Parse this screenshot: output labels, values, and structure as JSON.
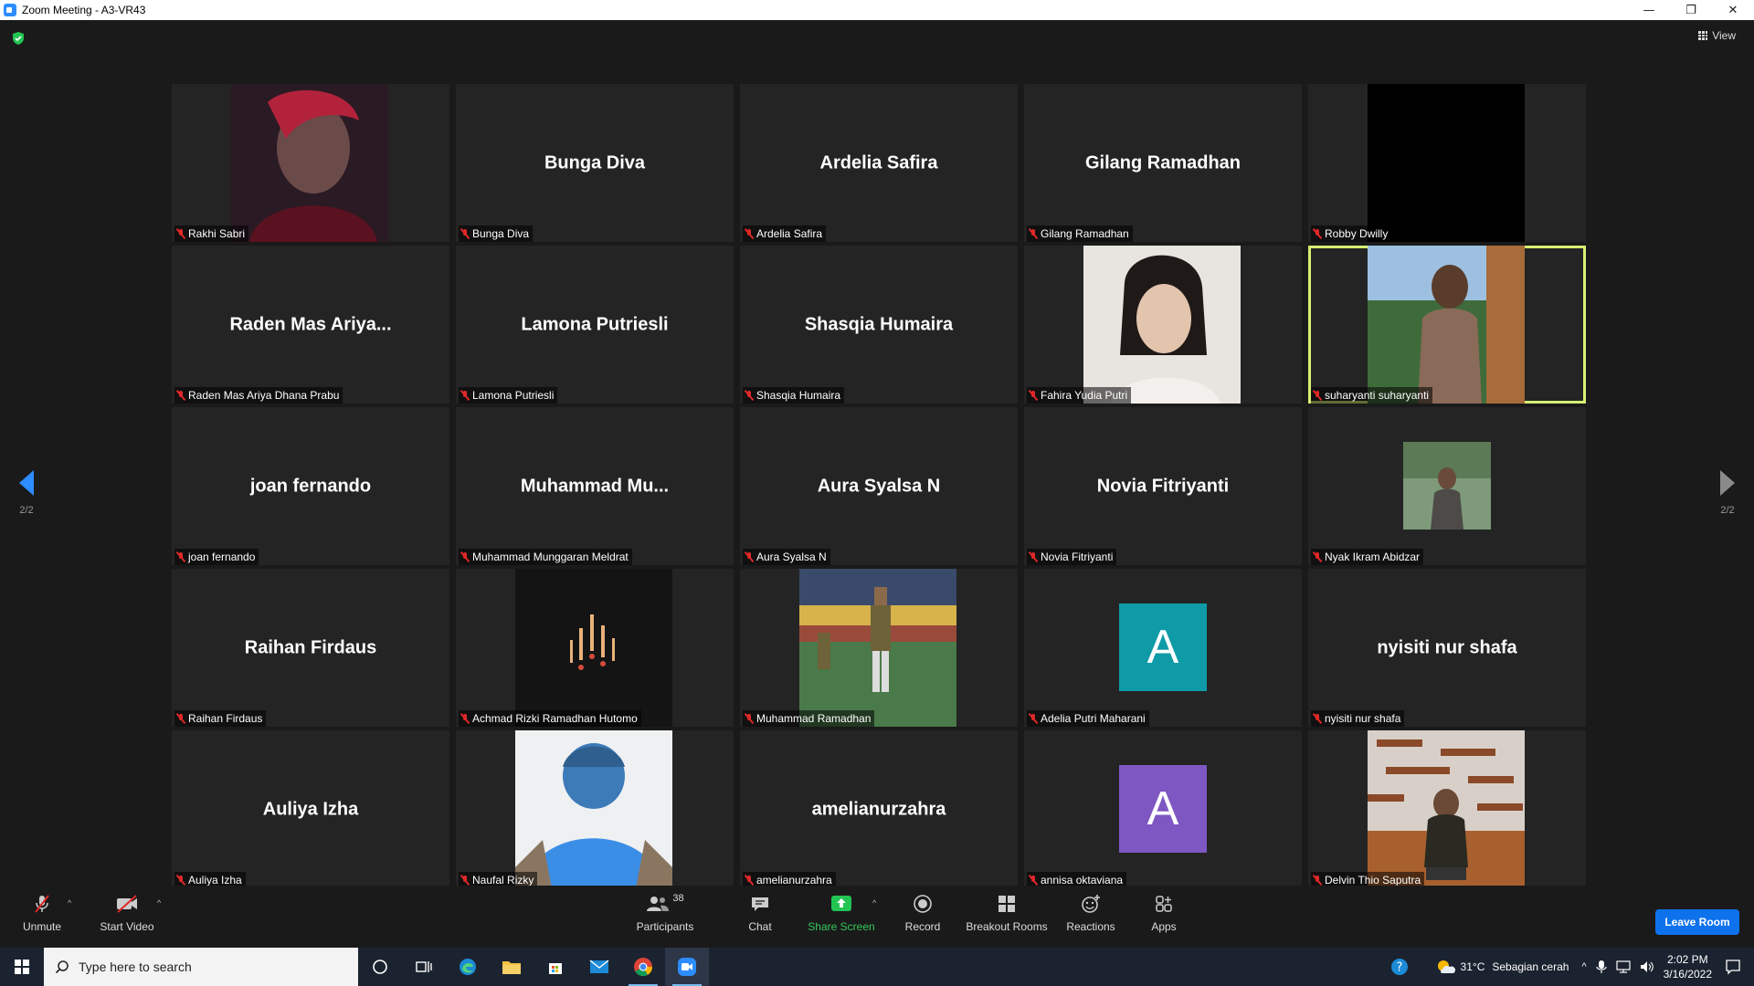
{
  "window": {
    "title": "Zoom Meeting - A3-VR43",
    "minimize": "—",
    "restore": "❐",
    "close": "✕"
  },
  "top_bar": {
    "view_label": "View"
  },
  "pagination": {
    "left": "2/2",
    "right": "2/2"
  },
  "participants": [
    {
      "display": "",
      "name": "Rakhi Sabri",
      "photo": "photo-red-hair"
    },
    {
      "display": "Bunga Diva",
      "name": "Bunga Diva"
    },
    {
      "display": "Ardelia Safira",
      "name": "Ardelia Safira"
    },
    {
      "display": "Gilang Ramadhan",
      "name": "Gilang Ramadhan"
    },
    {
      "display": "",
      "name": "Robby Dwilly",
      "photo": "photo-black"
    },
    {
      "display": "Raden Mas Ariya...",
      "name": "Raden Mas Ariya Dhana Prabu"
    },
    {
      "display": "Lamona Putriesli",
      "name": "Lamona Putriesli"
    },
    {
      "display": "Shasqia Humaira",
      "name": "Shasqia Humaira"
    },
    {
      "display": "",
      "name": "Fahira Yudia Putri",
      "photo": "photo-portrait-light"
    },
    {
      "display": "",
      "name": "suharyanti suharyanti",
      "photo": "photo-outdoor-woman",
      "active": true
    },
    {
      "display": "joan fernando",
      "name": "joan fernando"
    },
    {
      "display": "Muhammad  Mu...",
      "name": "Muhammad Munggaran Meldrat"
    },
    {
      "display": "Aura Syalsa N",
      "name": "Aura Syalsa N"
    },
    {
      "display": "Novia Fitriyanti",
      "name": "Novia Fitriyanti"
    },
    {
      "display": "",
      "name": "Nyak Ikram Abidzar",
      "photo": "photo-small-tree"
    },
    {
      "display": "Raihan Firdaus",
      "name": "Raihan Firdaus"
    },
    {
      "display": "",
      "name": "Achmad Rizki Ramadhan Hutomo",
      "photo": "photo-lights"
    },
    {
      "display": "",
      "name": "Muhammad Ramadhan",
      "photo": "photo-stadium"
    },
    {
      "display": "",
      "name": "Adelia Putri Maharani",
      "avatar": "A",
      "avatar_color": "#0e9aa7"
    },
    {
      "display": "nyisiti nur shafa",
      "name": "nyisiti nur shafa"
    },
    {
      "display": "Auliya Izha",
      "name": "Auliya Izha"
    },
    {
      "display": "",
      "name": "Naufal Rizky",
      "photo": "photo-blue-back"
    },
    {
      "display": "amelianurzahra",
      "name": "amelianurzahra"
    },
    {
      "display": "",
      "name": "annisa oktaviana",
      "avatar": "A",
      "avatar_color": "#7e57c2"
    },
    {
      "display": "",
      "name": "Delvin Thio Saputra",
      "photo": "photo-wood-wall"
    }
  ],
  "toolbar": {
    "unmute": "Unmute",
    "start_video": "Start Video",
    "participants": "Participants",
    "participant_count": "38",
    "chat": "Chat",
    "share_screen": "Share Screen",
    "record": "Record",
    "breakout_rooms": "Breakout Rooms",
    "reactions": "Reactions",
    "apps": "Apps",
    "leave_room": "Leave Room"
  },
  "taskbar": {
    "search_placeholder": "Type here to search",
    "weather_temp": "31°C",
    "weather_text": "Sebagian cerah",
    "time": "2:02 PM",
    "date": "3/16/2022"
  },
  "colors": {
    "accent": "#2d8cff",
    "active_speaker": "#d6ef73",
    "leave": "#0e72ed",
    "muted": "#e02828"
  }
}
